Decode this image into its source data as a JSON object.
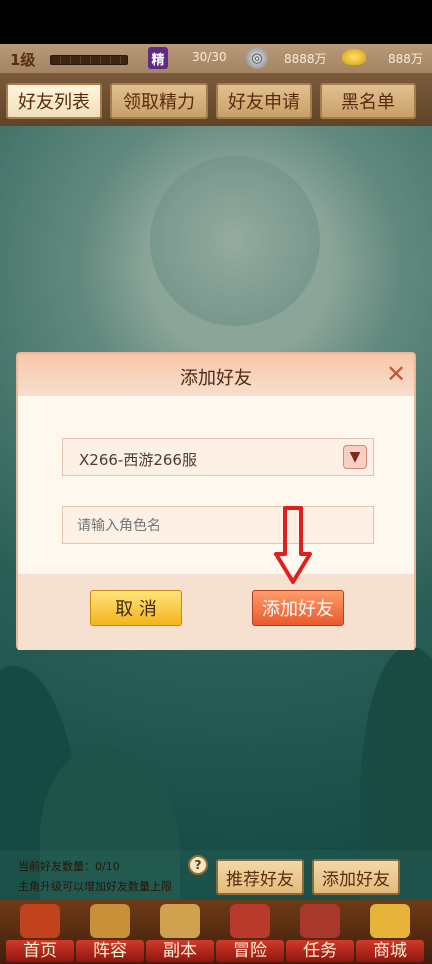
{
  "status": {
    "level": "1级",
    "energy_icon": "精",
    "energy_value": "30/30",
    "coins_value": "8888万",
    "gold_value": "888万"
  },
  "tabs": [
    {
      "label": "好友列表",
      "active": true
    },
    {
      "label": "领取精力",
      "active": false
    },
    {
      "label": "好友申请",
      "active": false
    },
    {
      "label": "黑名单",
      "active": false
    }
  ],
  "dialog": {
    "title": "添加好友",
    "server_select_value": "X266-西游266服",
    "name_input_placeholder": "请输入角色名",
    "cancel_label": "取 消",
    "add_label": "添加好友"
  },
  "footer": {
    "friend_count_line": "当前好友数量：0/10",
    "upgrade_hint": "主角升级可以增加好友数量上限",
    "help_label": "?",
    "recommend_label": "推荐好友",
    "add_friend_label": "添加好友"
  },
  "nav": [
    {
      "label": "首页",
      "icon": "home-icon"
    },
    {
      "label": "阵容",
      "icon": "formation-icon"
    },
    {
      "label": "副本",
      "icon": "dungeon-icon"
    },
    {
      "label": "冒险",
      "icon": "adventure-icon"
    },
    {
      "label": "任务",
      "icon": "task-icon"
    },
    {
      "label": "商城",
      "icon": "shop-icon"
    }
  ],
  "colors": {
    "accent_red": "#e9592d",
    "gold": "#f2b51a",
    "annotation_arrow": "#e02020"
  }
}
